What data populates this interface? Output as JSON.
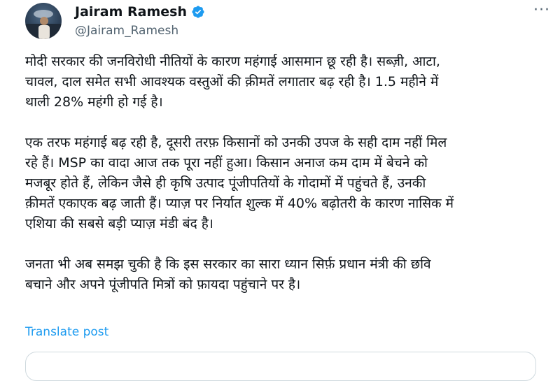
{
  "author": {
    "display_name": "Jairam Ramesh",
    "handle": "@Jairam_Ramesh",
    "verified_icon": "verified-badge-icon",
    "verified_color": "#1d9bf0"
  },
  "menu": {
    "more_icon": "more-horizontal-icon"
  },
  "tweet": {
    "paragraphs": [
      "मोदी सरकार की जनविरोधी नीतियों के कारण महंगाई आसमान छू रही है। सब्ज़ी, आटा,\nचावल, दाल समेत सभी आवश्यक वस्तुओं की क़ीमतें लगातार बढ़ रही है। 1.5 महीने में\nथाली 28% महंगी हो गई है।",
      "एक तरफ महंगाई बढ़ रही है, दूसरी तरफ़ किसानों को उनकी उपज के सही दाम नहीं मिल\nरहे हैं। MSP का वादा आज तक पूरा नहीं हुआ। किसान अनाज कम दाम में बेचने को\nमजबूर होते हैं, लेकिन जैसे ही कृषि उत्पाद पूंजीपतियों के गोदामों में पहुंचते हैं, उनकी\nक़ीमतें एकाएक बढ़ जाती हैं। प्याज़ पर निर्यात शुल्क में 40% बढ़ोतरी के कारण नासिक में\nएशिया की सबसे बड़ी प्याज़ मंडी बंद है।",
      "जनता भी अब समझ चुकी है कि इस सरकार का सारा ध्यान सिर्फ़ प्रधान मंत्री की छवि\nबचाने और अपने पूंजीपति मित्रों को फ़ायदा पहुंचाने पर है।"
    ],
    "translate_label": "Translate post"
  },
  "colors": {
    "text": "#0f1419",
    "secondary": "#536471",
    "link": "#1d9bf0",
    "border": "#cfd9de"
  }
}
